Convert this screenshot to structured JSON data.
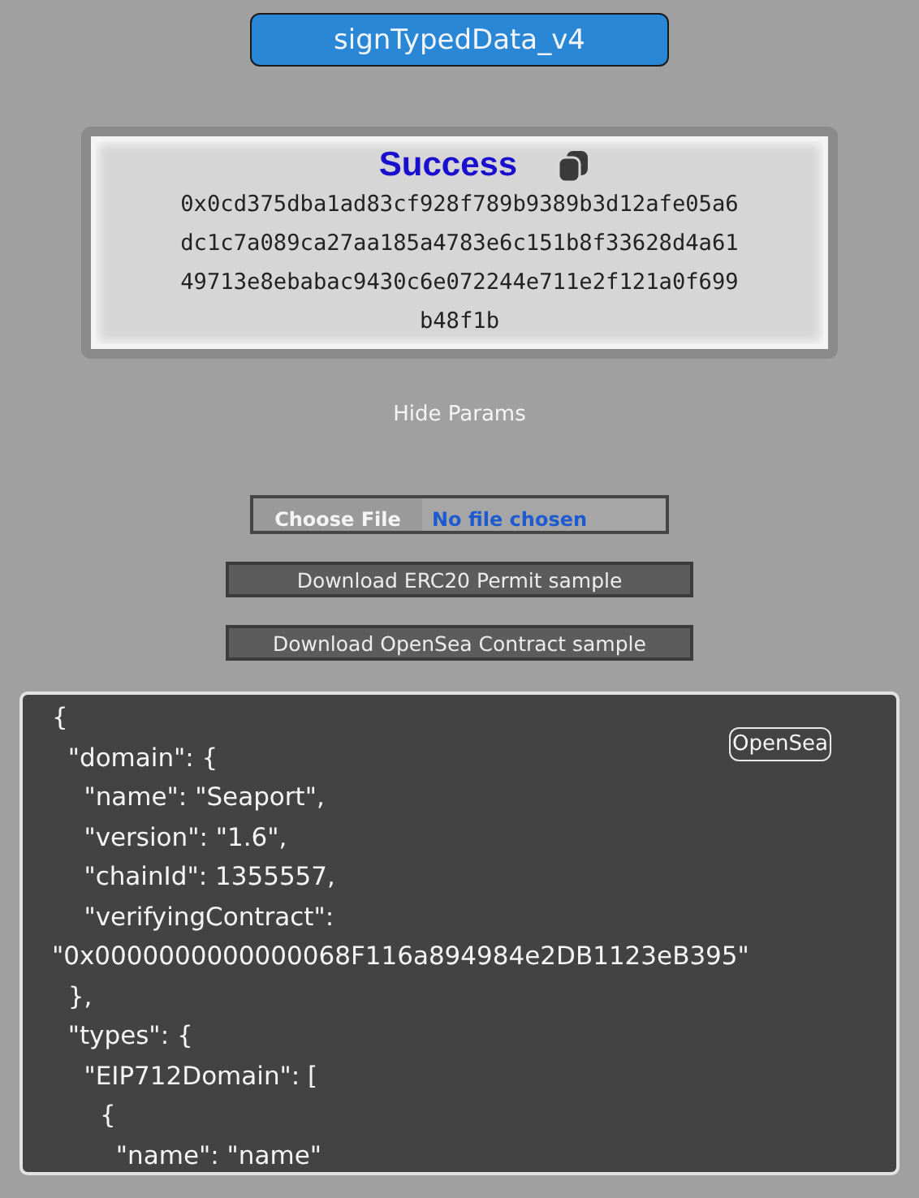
{
  "method_button": {
    "label": "signTypedData_v4"
  },
  "result": {
    "status": "Success",
    "signature": "0x0cd375dba1ad83cf928f789b9389b3d12afe05a6dc1c7a089ca27aa185a4783e6c151b8f33628d4a6149713e8ebabac9430c6e072244e711e2f121a0f699b48f1b"
  },
  "params_toggle": {
    "label": "Hide Params"
  },
  "file_input": {
    "button": "Choose File",
    "status": "No file chosen"
  },
  "download_buttons": [
    "Download ERC20 Permit sample",
    "Download OpenSea Contract sample"
  ],
  "editor": {
    "preset_button": "OpenSea",
    "lines": [
      "{",
      "  \"domain\": {",
      "    \"name\": \"Seaport\",",
      "    \"version\": \"1.6\",",
      "    \"chainId\": 1355557,",
      "    \"verifyingContract\":",
      "\"0x0000000000000068F116a894984e2DB1123eB395\"",
      "  },",
      "  \"types\": {",
      "    \"EIP712Domain\": [",
      "      {",
      "        \"name\": \"name\""
    ]
  }
}
